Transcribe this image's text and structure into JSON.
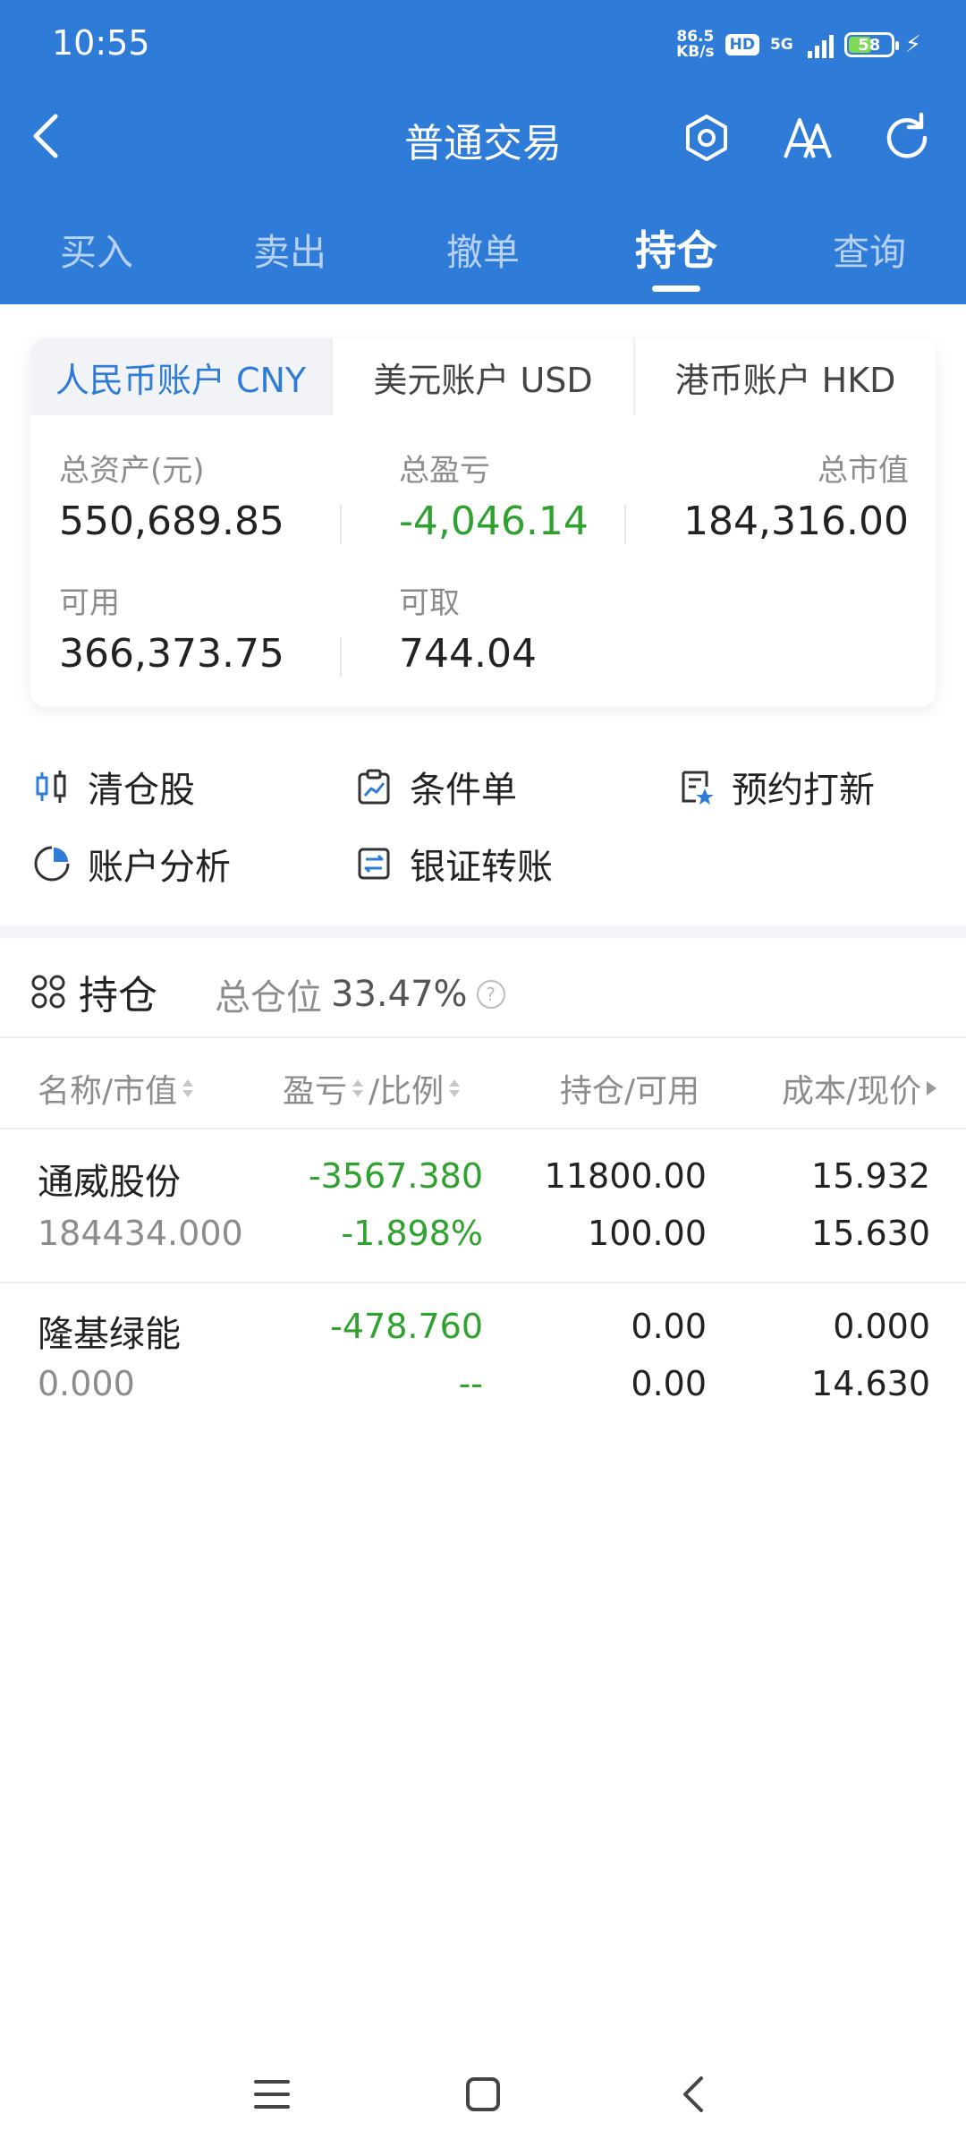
{
  "status_bar": {
    "time": "10:55",
    "net_speed_value": "86.5",
    "net_speed_unit": "KB/s",
    "hd_label": "HD",
    "signal_label": "5G",
    "battery": "58",
    "battery_level": 0.58
  },
  "header": {
    "title": "普通交易",
    "icons": [
      "back-icon",
      "settings-hexagon-icon",
      "font-size-icon",
      "refresh-icon"
    ]
  },
  "tabs": [
    {
      "label": "买入",
      "active": false
    },
    {
      "label": "卖出",
      "active": false
    },
    {
      "label": "撤单",
      "active": false
    },
    {
      "label": "持仓",
      "active": true
    },
    {
      "label": "查询",
      "active": false
    }
  ],
  "account_tabs": [
    "人民币账户 CNY",
    "美元账户 USD",
    "港币账户 HKD"
  ],
  "summary": {
    "total_assets_label": "总资产(元)",
    "total_assets": "550,689.85",
    "total_pnl_label": "总盈亏",
    "total_pnl": "-4,046.14",
    "market_value_label": "总市值",
    "market_value": "184,316.00",
    "available_label": "可用",
    "available": "366,373.75",
    "withdrawable_label": "可取",
    "withdrawable": "744.04"
  },
  "shortcuts": [
    {
      "label": "清仓股",
      "icon": "candlestick-icon"
    },
    {
      "label": "条件单",
      "icon": "clipboard-chart-icon"
    },
    {
      "label": "预约打新",
      "icon": "reservation-star-icon"
    },
    {
      "label": "账户分析",
      "icon": "pie-chart-icon"
    },
    {
      "label": "银证转账",
      "icon": "transfer-icon"
    }
  ],
  "holdings": {
    "title": "持仓",
    "position_ratio_label": "总仓位",
    "position_ratio": "33.47%",
    "columns": [
      "名称/市值",
      "盈亏",
      "/比例",
      "持仓/可用",
      "成本/现价"
    ],
    "rows": [
      {
        "name": "通威股份",
        "market_value": "184434.000",
        "pnl": "-3567.380",
        "pnl_ratio": "-1.898%",
        "position": "11800.00",
        "available": "100.00",
        "cost": "15.932",
        "price": "15.630"
      },
      {
        "name": "隆基绿能",
        "market_value": "0.000",
        "pnl": "-478.760",
        "pnl_ratio": "--",
        "position": "0.00",
        "available": "0.00",
        "cost": "0.000",
        "price": "14.630"
      }
    ]
  },
  "colors": {
    "brand_blue": "#2f7bd8",
    "loss_green": "#2ea12e",
    "muted_text": "#8c8c8c"
  }
}
